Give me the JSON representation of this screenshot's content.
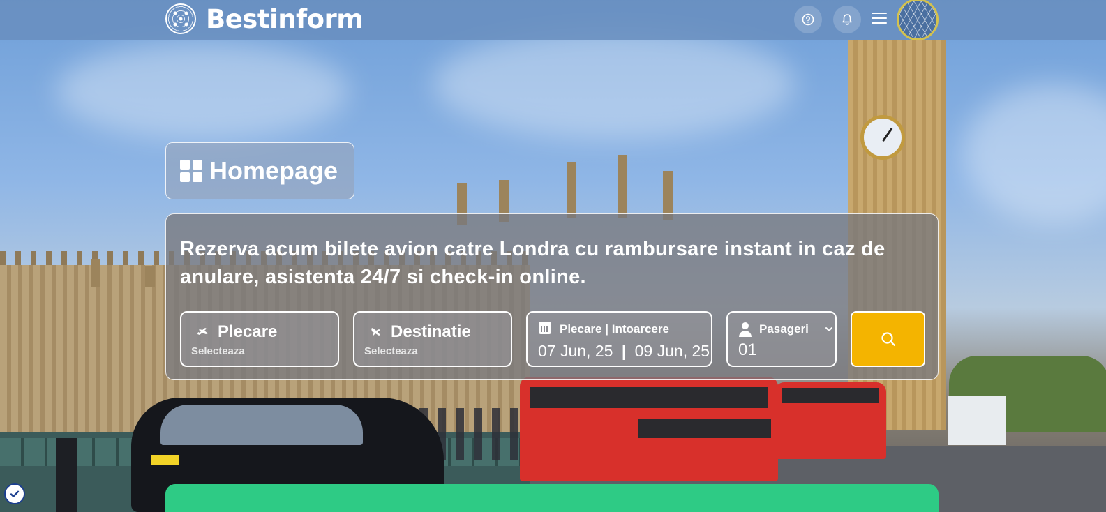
{
  "header": {
    "brand": "Bestinform",
    "icons": [
      "help-icon",
      "bell-icon",
      "menu-icon",
      "avatar"
    ]
  },
  "page": {
    "title": "Homepage"
  },
  "search": {
    "headline": "Rezerva acum bilete avion catre Londra cu rambursare instant in caz de anulare, asistenta 24/7 si check-in online.",
    "departure": {
      "label": "Plecare",
      "value": "Selecteaza",
      "icon": "plane-takeoff-icon"
    },
    "destination": {
      "label": "Destinatie",
      "value": "Selecteaza",
      "icon": "plane-landing-icon"
    },
    "dates": {
      "label_depart": "Plecare",
      "separator": "|",
      "label_return": "Intoarcere",
      "depart_value": "07 Jun, 25",
      "return_value": "09 Jun, 25",
      "icon": "calendar-icon"
    },
    "passengers": {
      "label": "Pasageri",
      "value": "01",
      "icon": "person-icon"
    },
    "button_icon": "search-icon"
  },
  "colors": {
    "accent": "#f4b400",
    "strip": "#2ecb85",
    "header": "#688ebe"
  }
}
